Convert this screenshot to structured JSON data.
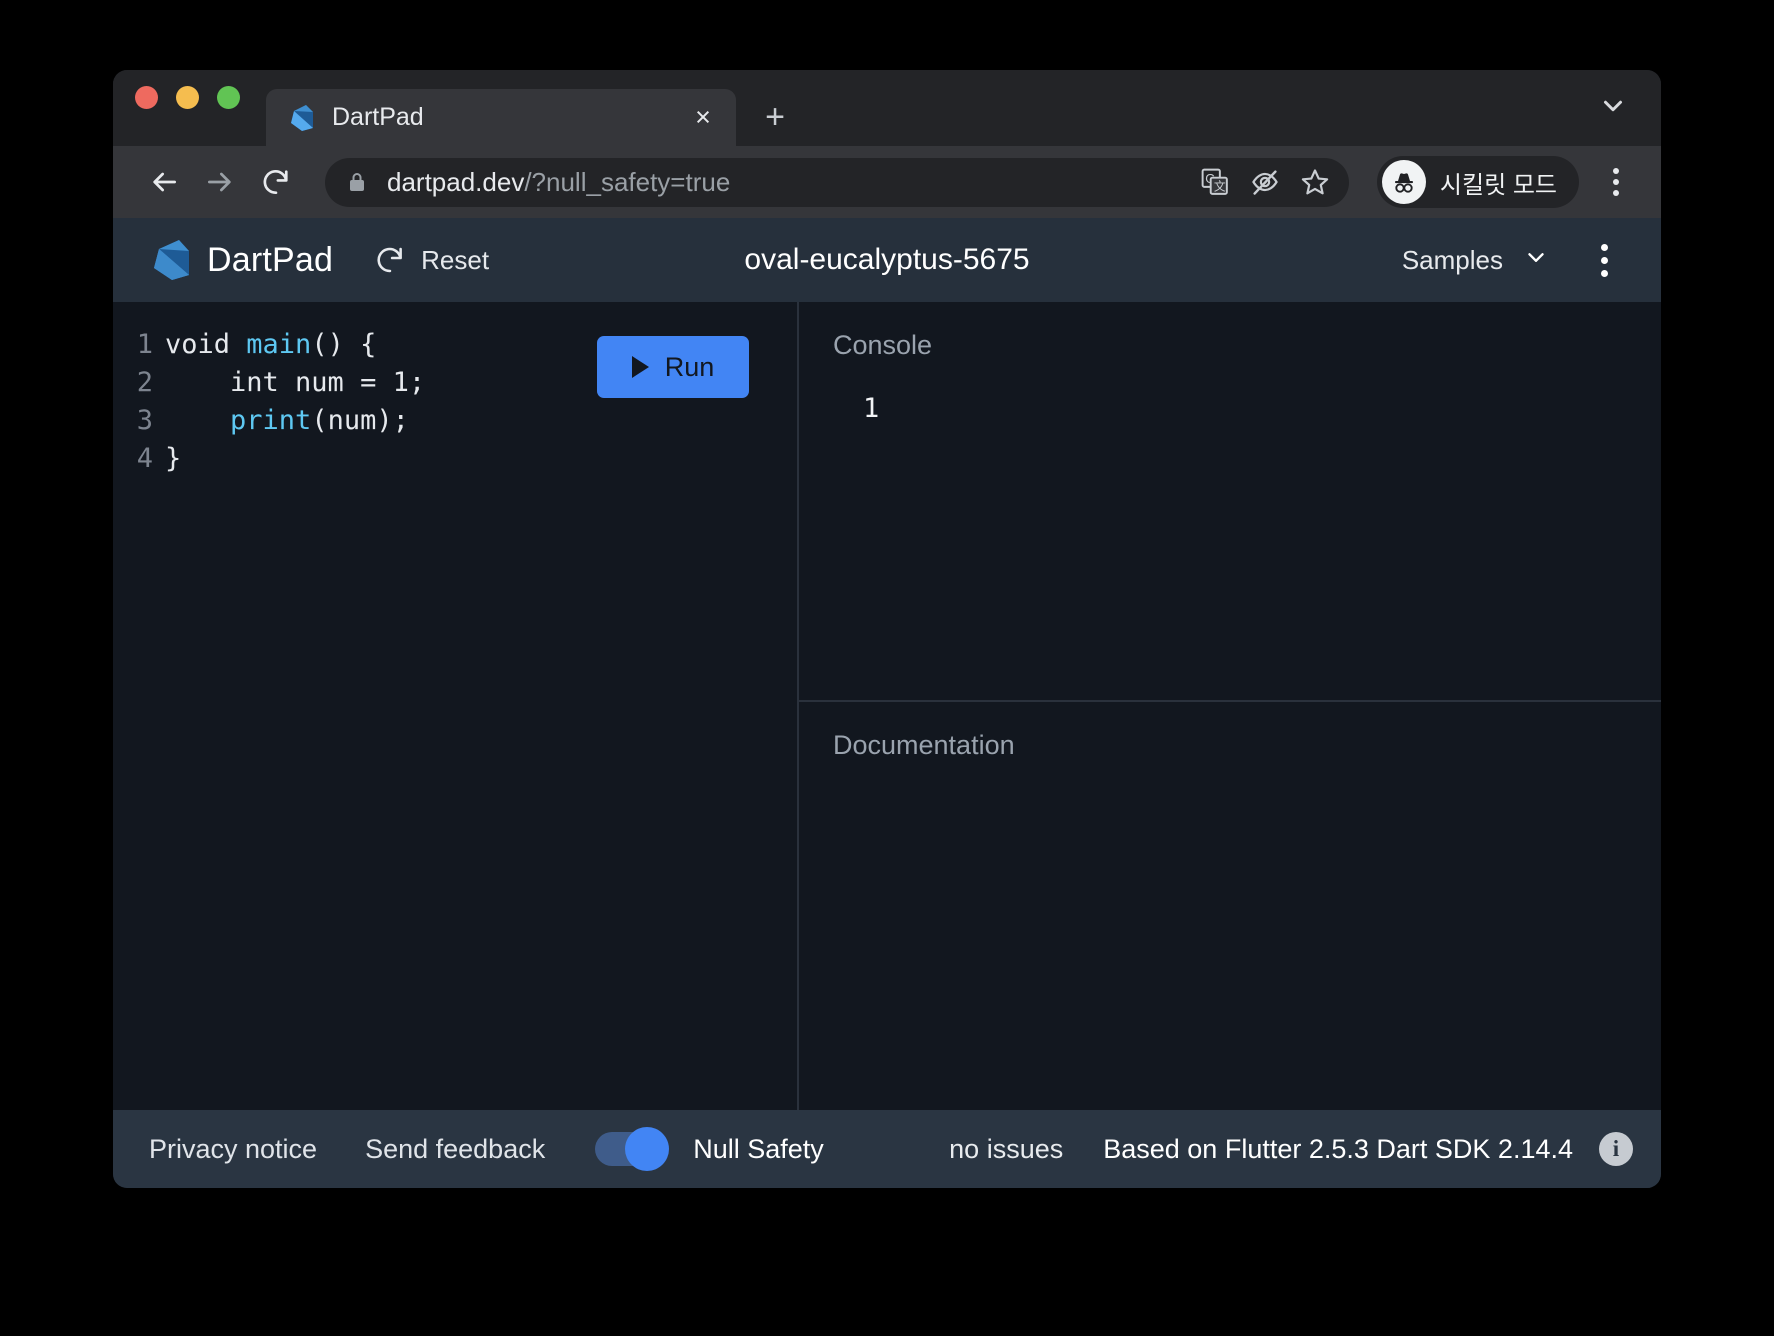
{
  "browser": {
    "window_controls": [
      "close",
      "minimize",
      "maximize"
    ],
    "tab": {
      "title": "DartPad",
      "favicon": "dart-logo-icon",
      "close_label": "×"
    },
    "new_tab_label": "+",
    "tabstrip_chevron": "chevron-down-icon",
    "toolbar": {
      "back": "back-arrow-icon",
      "forward": "forward-arrow-icon",
      "reload": "reload-icon",
      "lock": "lock-icon",
      "url_domain": "dartpad.dev",
      "url_path": "/?null_safety=true",
      "translate_icon": "translate-icon",
      "hide_icon": "eye-off-icon",
      "bookmark_icon": "star-icon",
      "incognito_label": "시킬릿 모드",
      "menu_icon": "kebab-menu-icon"
    }
  },
  "app": {
    "brand": "DartPad",
    "reset_label": "Reset",
    "gist_name": "oval-eucalyptus-5675",
    "samples_label": "Samples",
    "samples_chevron": "chevron-down-icon",
    "more_menu": "kebab-menu-icon"
  },
  "editor": {
    "run_label": "Run",
    "run_icon": "play-icon",
    "lines": [
      {
        "num": "1",
        "segments": [
          {
            "t": "void ",
            "c": "kw"
          },
          {
            "t": "main",
            "c": "fn"
          },
          {
            "t": "() {",
            "c": "plain"
          }
        ]
      },
      {
        "num": "2",
        "segments": [
          {
            "t": "    int num = ",
            "c": "plain"
          },
          {
            "t": "1",
            "c": "num"
          },
          {
            "t": ";",
            "c": "plain"
          }
        ]
      },
      {
        "num": "3",
        "segments": [
          {
            "t": "    ",
            "c": "plain"
          },
          {
            "t": "print",
            "c": "fn"
          },
          {
            "t": "(num);",
            "c": "plain"
          }
        ]
      },
      {
        "num": "4",
        "segments": [
          {
            "t": "}",
            "c": "plain"
          }
        ]
      }
    ]
  },
  "console": {
    "title": "Console",
    "output": "1"
  },
  "documentation": {
    "title": "Documentation",
    "body": ""
  },
  "footer": {
    "privacy_label": "Privacy notice",
    "feedback_label": "Send feedback",
    "null_safety_label": "Null Safety",
    "null_safety_on": true,
    "issues": "no issues",
    "sdk_info": "Based on Flutter 2.5.3 Dart SDK 2.14.4",
    "info_icon_label": "i"
  },
  "colors": {
    "accent": "#4285f4",
    "app_header_bg": "#26303c",
    "editor_bg": "#12171f",
    "footer_bg": "#2a3542",
    "chrome_tabstrip": "#232427",
    "chrome_toolbar": "#35363a"
  }
}
